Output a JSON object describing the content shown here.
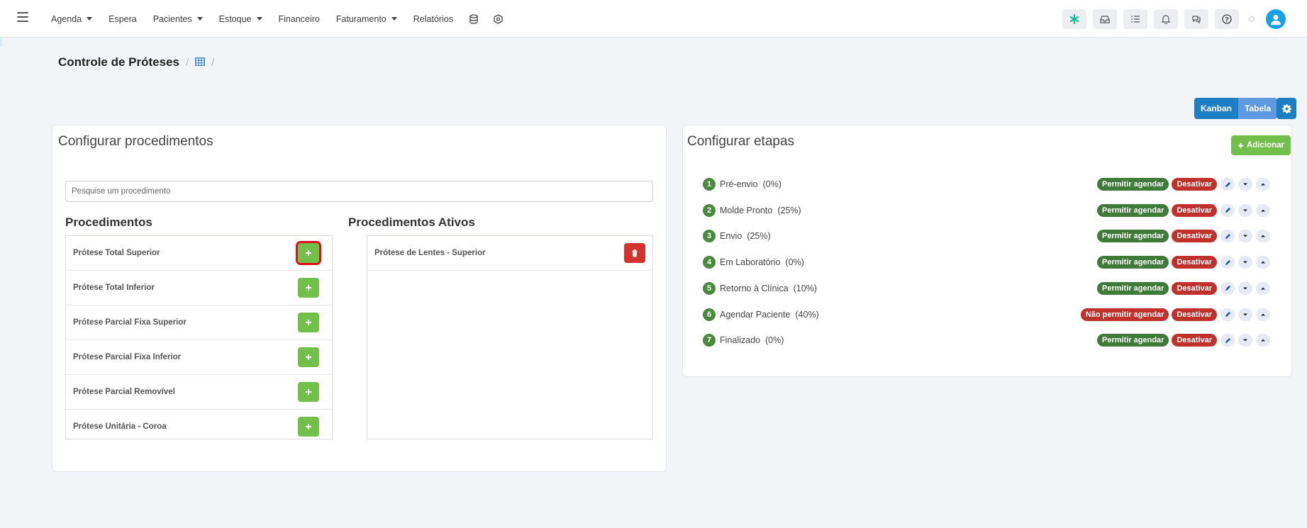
{
  "navbar": {
    "menu": [
      {
        "label": "Agenda",
        "caret": true
      },
      {
        "label": "Espera",
        "caret": false
      },
      {
        "label": "Pacientes",
        "caret": true
      },
      {
        "label": "Estoque",
        "caret": true
      },
      {
        "label": "Financeiro",
        "caret": false
      },
      {
        "label": "Faturamento",
        "caret": true
      },
      {
        "label": "Relatórios",
        "caret": false
      }
    ],
    "extra_icons": [
      "database-icon",
      "hexagon-settings-icon"
    ],
    "right_icons": [
      "star-icon",
      "inbox-icon",
      "checklist-icon",
      "bell-icon",
      "chat-icon",
      "help-icon"
    ]
  },
  "breadcrumb": {
    "title": "Controle de Próteses",
    "icon": "table-grid-icon"
  },
  "view_toggle": {
    "kanban": "Kanban",
    "tabela": "Tabela"
  },
  "procedures_card": {
    "title": "Configurar procedimentos",
    "search_placeholder": "Pesquise um procedimento",
    "left_heading": "Procedimentos",
    "right_heading": "Procedimentos Ativos",
    "procedures": [
      "Prótese Total Superior",
      "Prótese Total Inferior",
      "Prótese Parcial Fixa Superior",
      "Prótese Parcial Fixa Inferior",
      "Prótese Parcial Removível",
      "Prótese Unitária - Coroa"
    ],
    "active_procedures": [
      "Prótese de Lentes - Superior"
    ]
  },
  "stages_card": {
    "title": "Configurar etapas",
    "add_label": "Adicionar",
    "stages": [
      {
        "num": "1",
        "name": "Pré-envio",
        "pct": "(0%)",
        "schedule": "Permitir agendar",
        "schedule_allowed": true,
        "deactivate": "Desativar"
      },
      {
        "num": "2",
        "name": "Molde Pronto",
        "pct": "(25%)",
        "schedule": "Permitir agendar",
        "schedule_allowed": true,
        "deactivate": "Desativar"
      },
      {
        "num": "3",
        "name": "Envio",
        "pct": "(25%)",
        "schedule": "Permitir agendar",
        "schedule_allowed": true,
        "deactivate": "Desativar"
      },
      {
        "num": "4",
        "name": "Em Laboratório",
        "pct": "(0%)",
        "schedule": "Permitir agendar",
        "schedule_allowed": true,
        "deactivate": "Desativar"
      },
      {
        "num": "5",
        "name": "Retorno à Clínica",
        "pct": "(10%)",
        "schedule": "Permitir agendar",
        "schedule_allowed": true,
        "deactivate": "Desativar"
      },
      {
        "num": "6",
        "name": "Agendar Paciente",
        "pct": "(40%)",
        "schedule": "Não permitir agendar",
        "schedule_allowed": false,
        "deactivate": "Desativar"
      },
      {
        "num": "7",
        "name": "Finalizado",
        "pct": "(0%)",
        "schedule": "Permitir agendar",
        "schedule_allowed": true,
        "deactivate": "Desativar"
      }
    ]
  },
  "colors": {
    "primary": "#1e7ec3",
    "primary_light": "#5d9ae0",
    "success": "#72c04b",
    "badge_green": "#3f7a3a",
    "danger": "#c0312b",
    "avatar": "#1aa0e8"
  }
}
